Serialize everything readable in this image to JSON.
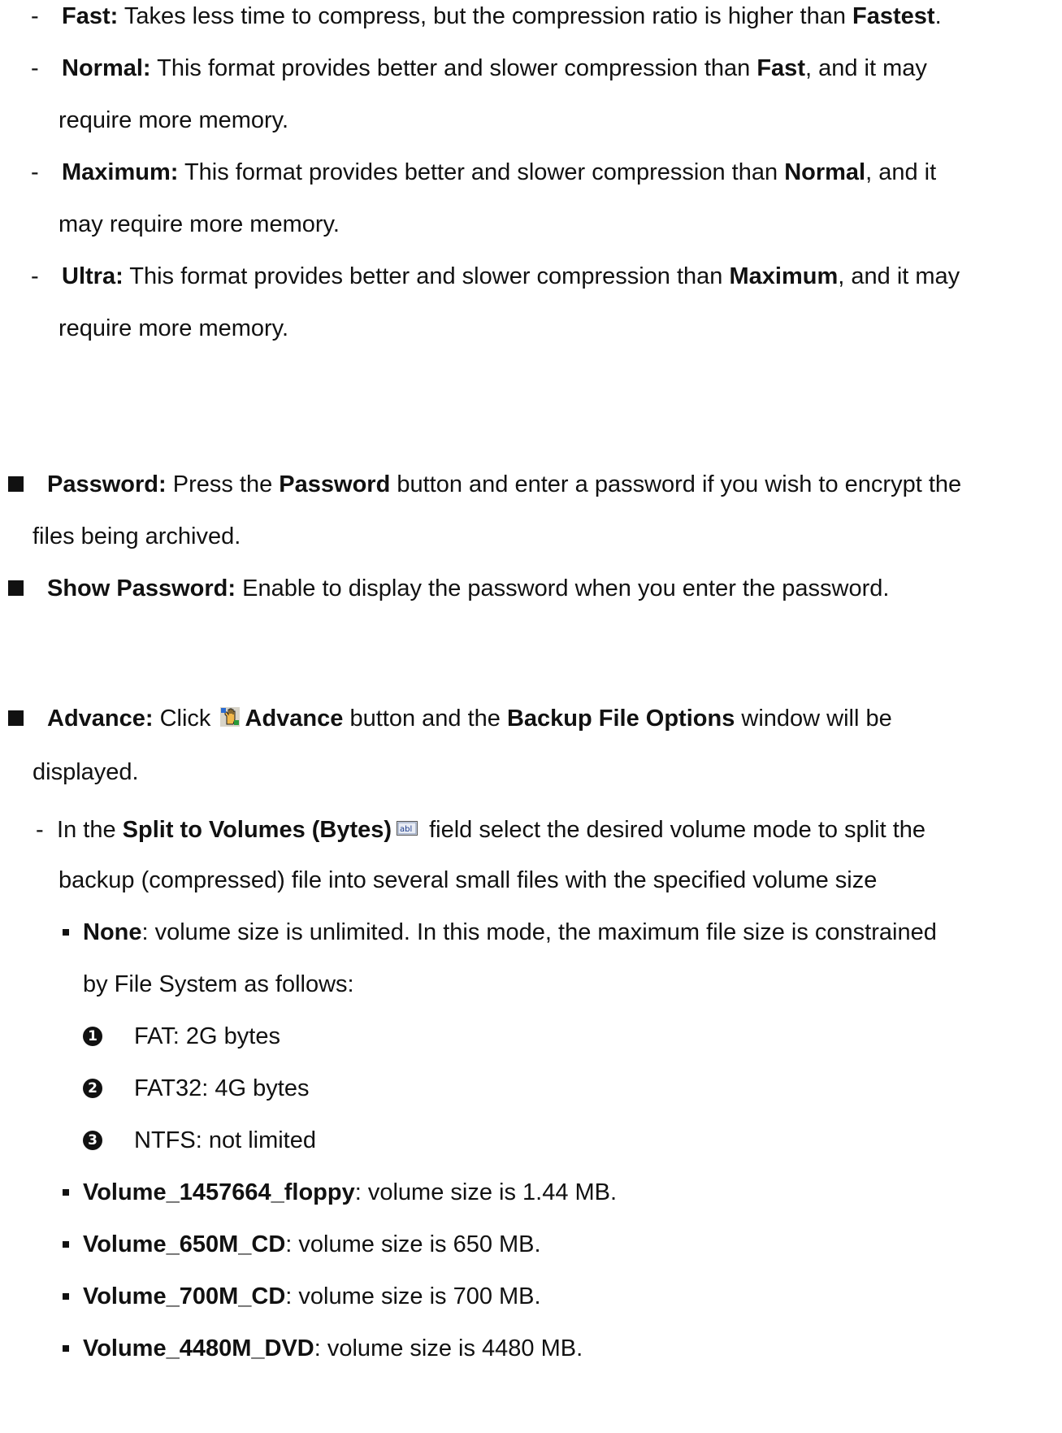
{
  "compression_levels": [
    {
      "dash": "-",
      "name": "Fast:",
      "text_before": " Takes less time to compress, but the compression ratio is higher than ",
      "ref": "Fastest",
      "text_after": ".",
      "line2": ""
    },
    {
      "dash": "-",
      "name": "Normal:",
      "text_before": " This format provides better and slower compression than ",
      "ref": "Fast",
      "text_after": ", and it may",
      "line2": "require more memory."
    },
    {
      "dash": "-",
      "name": "Maximum:",
      "text_before": " This format provides better and slower compression than ",
      "ref": "Normal",
      "text_after": ", and it",
      "line2": "may require more memory."
    },
    {
      "dash": "-",
      "name": "Ultra:",
      "text_before": " This format provides better and slower compression than ",
      "ref": "Maximum",
      "text_after": ", and it may",
      "line2": "require more memory."
    }
  ],
  "password": {
    "label": "Password:",
    "t1": " Press the ",
    "button": "Password",
    "t2": " button and enter a password if you wish to encrypt the",
    "line2": "files being archived."
  },
  "show_password": {
    "label": "Show Password:",
    "text": " Enable to display the password when you enter the password."
  },
  "advance": {
    "label": "Advance:",
    "t1": " Click ",
    "button": "Advance",
    "t2": " button and the ",
    "window": "Backup File Options",
    "t3": " window will be",
    "line2": "displayed.",
    "icon": "advance-hand-icon"
  },
  "split": {
    "dash": "-",
    "t1": " In the ",
    "field": "Split to Volumes (Bytes)",
    "t2": "field select the desired volume mode to split the",
    "line2": "backup (compressed) file into several small files with the specified volume size",
    "icon": "text-field-icon"
  },
  "none_option": {
    "name": "None",
    "text": ": volume size is unlimited. In this mode, the maximum file size is constrained",
    "line2": "by File System as follows:"
  },
  "filesystems": [
    {
      "num": "1",
      "text": "FAT: 2G bytes"
    },
    {
      "num": "2",
      "text": "FAT32: 4G bytes"
    },
    {
      "num": "3",
      "text": "NTFS: not limited"
    }
  ],
  "volumes": [
    {
      "name": "Volume_1457664_floppy",
      "text": ": volume size is 1.44 MB."
    },
    {
      "name": "Volume_650M_CD",
      "text": ": volume size is 650 MB."
    },
    {
      "name": "Volume_700M_CD",
      "text": ": volume size is 700 MB."
    },
    {
      "name": "Volume_4480M_DVD",
      "text": ": volume size is 4480 MB."
    }
  ]
}
